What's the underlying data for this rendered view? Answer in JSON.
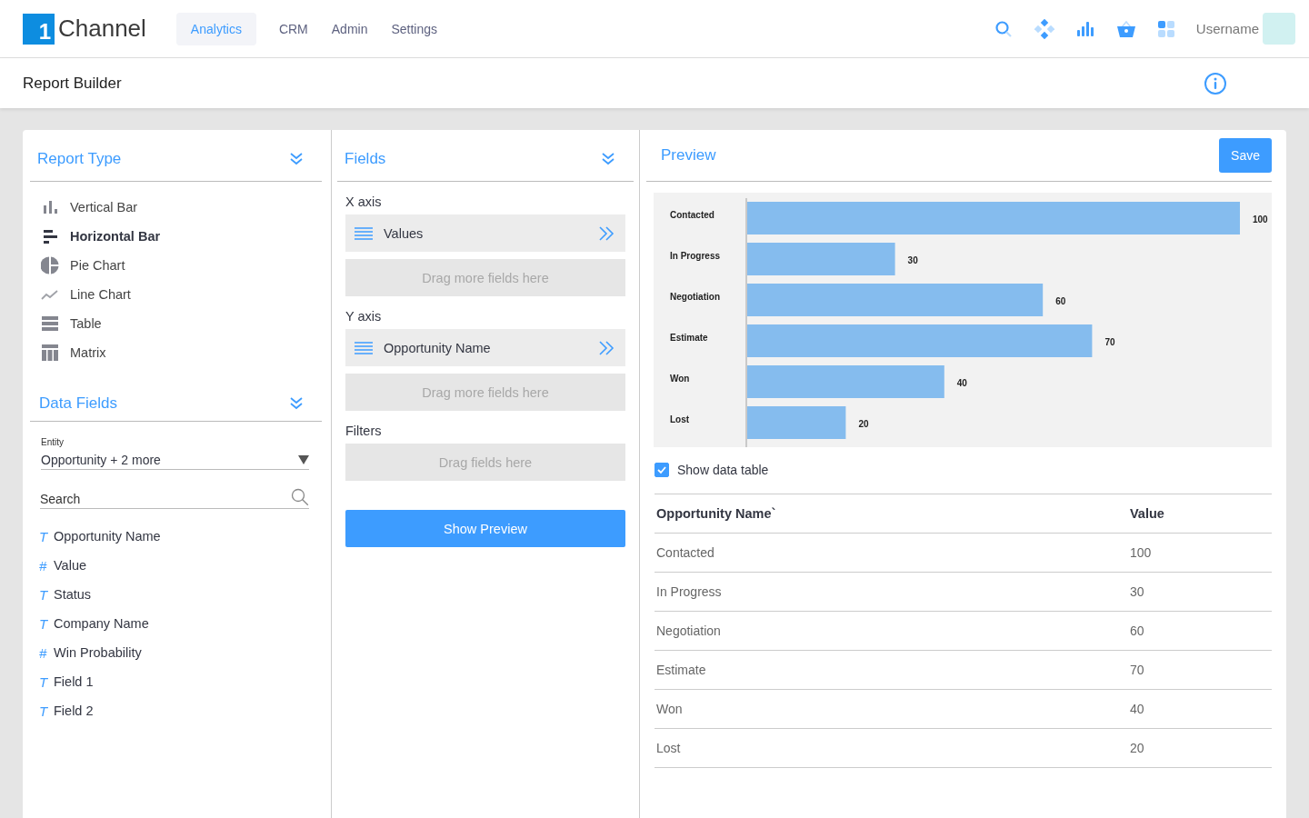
{
  "top_bar": {
    "logo": {
      "mark": "1",
      "text": "Channel"
    },
    "menu": [
      {
        "label": "Analytics",
        "selected": true
      },
      {
        "label": "CRM",
        "selected": false
      },
      {
        "label": "Admin",
        "selected": false
      },
      {
        "label": "Settings",
        "selected": false
      }
    ],
    "username": "Username"
  },
  "page_title": "Report Builder",
  "report_type": {
    "title": "Report Type",
    "items": [
      {
        "label": "Vertical Bar",
        "kind": "vertical-bar",
        "selected": false
      },
      {
        "label": "Horizontal Bar",
        "kind": "horizontal-bar",
        "selected": true
      },
      {
        "label": "Pie Chart",
        "kind": "pie",
        "selected": false
      },
      {
        "label": "Line Chart",
        "kind": "line",
        "selected": false
      },
      {
        "label": "Table",
        "kind": "table",
        "selected": false
      },
      {
        "label": "Matrix",
        "kind": "matrix",
        "selected": false
      }
    ]
  },
  "data_fields": {
    "title": "Data Fields",
    "entity": {
      "label": "Entity",
      "value": "Opportunity + 2 more"
    },
    "search": {
      "placeholder": "Search"
    },
    "fields": [
      {
        "symbol": "T",
        "label": "Opportunity Name"
      },
      {
        "symbol": "#",
        "label": "Value"
      },
      {
        "symbol": "T",
        "label": "Status"
      },
      {
        "symbol": "T",
        "label": "Company Name"
      },
      {
        "symbol": "#",
        "label": "Win Probability"
      },
      {
        "symbol": "T",
        "label": "Field 1"
      },
      {
        "symbol": "T",
        "label": "Field 2"
      }
    ]
  },
  "fields_panel": {
    "title": "Fields",
    "x_axis": {
      "label": "X axis",
      "items": [
        "Values"
      ],
      "drop_hint": "Drag more fields here"
    },
    "y_axis": {
      "label": "Y axis",
      "items": [
        "Opportunity Name"
      ],
      "drop_hint": "Drag more fields here"
    },
    "filters": {
      "label": "Filters",
      "drop_hint": "Drag fields here"
    },
    "button": "Show Preview"
  },
  "preview": {
    "title": "Preview",
    "save": "Save",
    "chart_data": {
      "type": "bar",
      "orientation": "horizontal",
      "categories": [
        "Contacted",
        "In Progress",
        "Negotiation",
        "Estimate",
        "Won",
        "Lost"
      ],
      "series": [
        {
          "color": "#85bcee",
          "values": [
            100,
            30,
            60,
            70,
            40,
            20
          ]
        }
      ],
      "xlim": [
        0,
        100
      ],
      "data_labels": true
    },
    "show_data_table": {
      "label": "Show data table",
      "checked": true
    },
    "table": {
      "columns": [
        "Opportunity Name`",
        "Value"
      ],
      "rows": [
        [
          "Contacted",
          "100"
        ],
        [
          "In Progress",
          "30"
        ],
        [
          "Negotiation",
          "60"
        ],
        [
          "Estimate",
          "70"
        ],
        [
          "Won",
          "40"
        ],
        [
          "Lost",
          "20"
        ]
      ]
    }
  }
}
